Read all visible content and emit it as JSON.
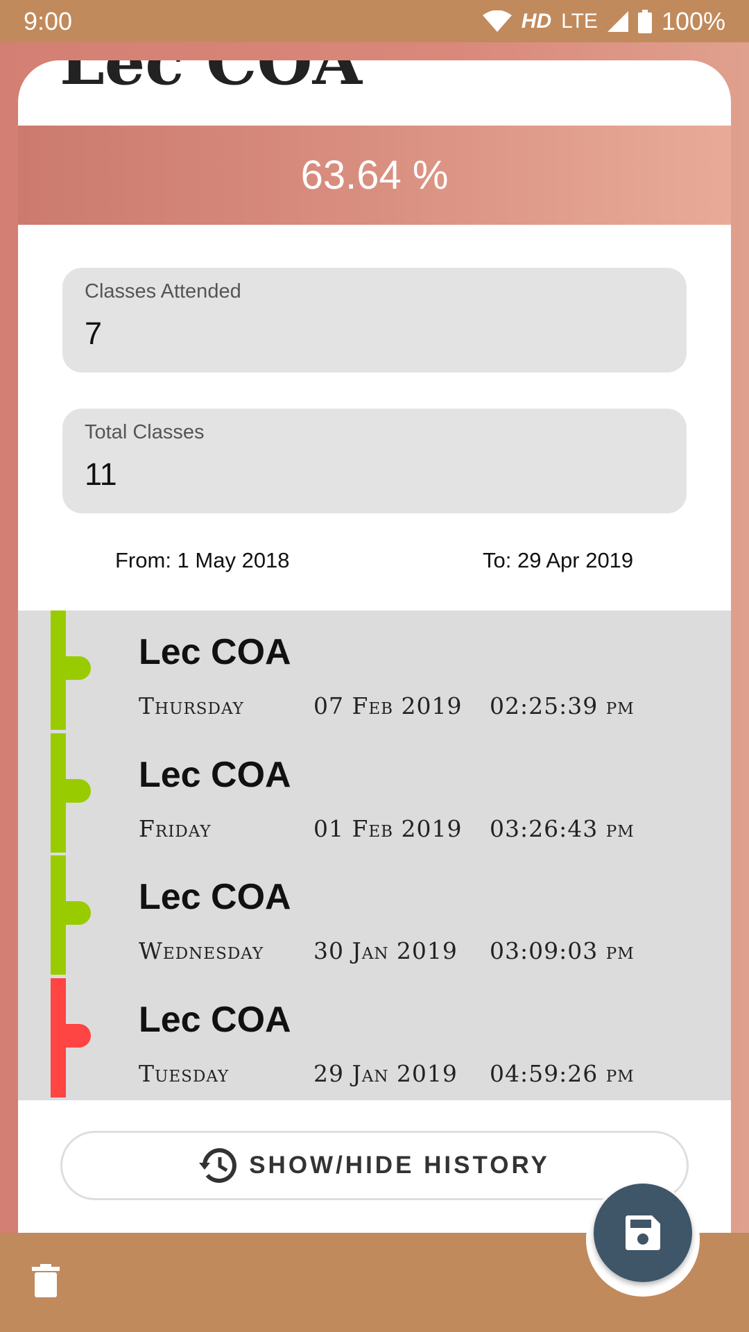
{
  "status_bar": {
    "time": "9:00",
    "hd": "HD",
    "network": "LTE",
    "battery": "100%"
  },
  "subject": {
    "title": "Lec COA",
    "percentage": "63.64 %"
  },
  "fields": {
    "attended": {
      "label": "Classes Attended",
      "value": "7"
    },
    "total": {
      "label": "Total Classes",
      "value": "11"
    }
  },
  "date_range": {
    "from": "From: 1 May 2018",
    "to": "To: 29 Apr 2019"
  },
  "history": [
    {
      "title": "Lec COA",
      "day": "Thursday",
      "date": "07 Feb 2019",
      "time": "02:25:39 pm",
      "status_color": "#99cc00"
    },
    {
      "title": "Lec COA",
      "day": "Friday",
      "date": "01 Feb 2019",
      "time": "03:26:43 pm",
      "status_color": "#99cc00"
    },
    {
      "title": "Lec COA",
      "day": "Wednesday",
      "date": "30 Jan 2019",
      "time": "03:09:03 pm",
      "status_color": "#99cc00"
    },
    {
      "title": "Lec COA",
      "day": "Tuesday",
      "date": "29 Jan 2019",
      "time": "04:59:26 pm",
      "status_color": "#ff4444"
    }
  ],
  "actions": {
    "history_toggle_label": "SHOW/HIDE HISTORY",
    "history_icon": "history-icon",
    "save_icon": "save-icon",
    "delete_icon": "delete-icon"
  },
  "colors": {
    "accent_bar": "#c18a5c",
    "fab": "#3f5568",
    "present": "#99cc00",
    "absent": "#ff4444"
  }
}
